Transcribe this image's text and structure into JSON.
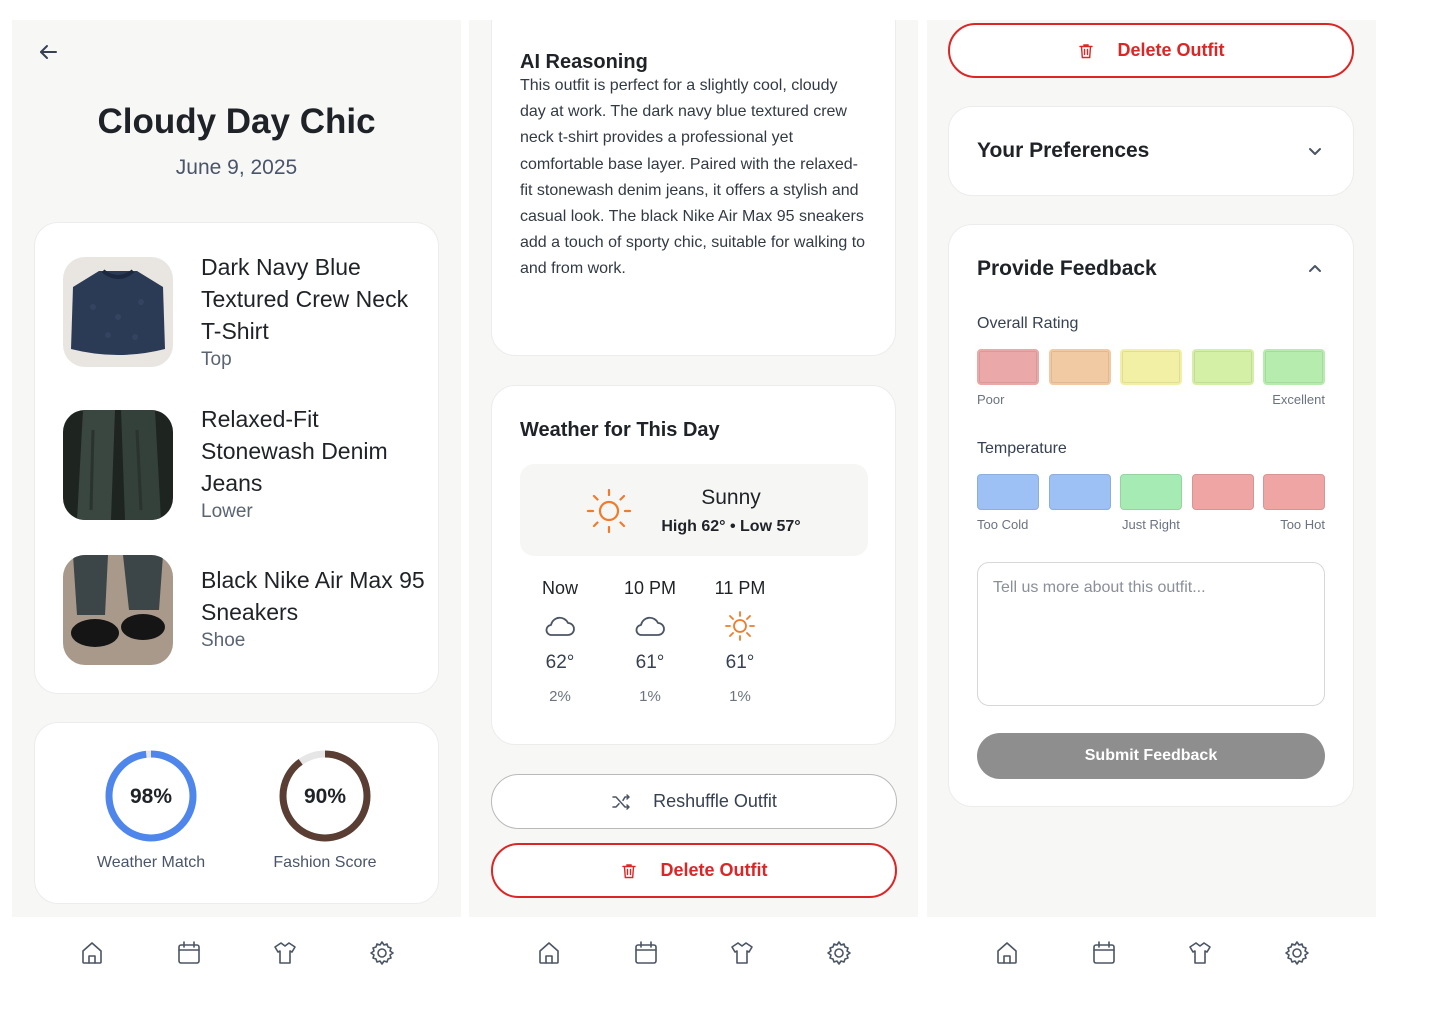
{
  "outfit": {
    "title": "Cloudy Day Chic",
    "date": "June 9, 2025",
    "items": [
      {
        "name": "Dark Navy Blue Textured Crew Neck T-Shirt",
        "category": "Top"
      },
      {
        "name": "Relaxed-Fit Stonewash Denim Jeans",
        "category": "Lower"
      },
      {
        "name": "Black Nike Air Max 95 Sneakers",
        "category": "Shoe"
      }
    ],
    "scores": [
      {
        "value_text": "98%",
        "value": 0.98,
        "label": "Weather Match",
        "color": "#4f86ec"
      },
      {
        "value_text": "90%",
        "value": 0.9,
        "label": "Fashion Score",
        "color": "#5a3d33"
      }
    ]
  },
  "reasoning": {
    "title": "AI Reasoning",
    "text": "This outfit is perfect for a slightly cool, cloudy day at work. The dark navy blue textured crew neck t-shirt provides a professional yet comfortable base layer. Paired with the relaxed-fit stonewash denim jeans, it offers a stylish and casual look. The black Nike Air Max 95 sneakers add a touch of sporty chic, suitable for walking to and from work."
  },
  "weather": {
    "title": "Weather for This Day",
    "condition": "Sunny",
    "hilo": "High 62° • Low 57°",
    "hours": [
      {
        "time": "Now",
        "icon": "cloud-icon",
        "temp": "62°",
        "precip": "2%"
      },
      {
        "time": "10 PM",
        "icon": "cloud-icon",
        "temp": "61°",
        "precip": "1%"
      },
      {
        "time": "11 PM",
        "icon": "sun-icon",
        "temp": "61°",
        "precip": "1%"
      }
    ]
  },
  "actions": {
    "reshuffle": "Reshuffle Outfit",
    "delete": "Delete Outfit"
  },
  "preferences": {
    "title": "Your Preferences"
  },
  "feedback": {
    "title": "Provide Feedback",
    "rating_label": "Overall Rating",
    "rating_colors": [
      "#e8a9a9",
      "#efc9a4",
      "#f2f0a8",
      "#d5efaa",
      "#b8ebb0"
    ],
    "rating_low": "Poor",
    "rating_high": "Excellent",
    "temperature_label": "Temperature",
    "temperature_colors": [
      "#9ec1f5",
      "#9ec1f5",
      "#a7ebb4",
      "#f0a5a5",
      "#f0a5a5"
    ],
    "temp_cold": "Too Cold",
    "temp_right": "Just Right",
    "temp_hot": "Too Hot",
    "placeholder": "Tell us more about this outfit...",
    "submit": "Submit Feedback"
  },
  "nav": [
    "home-icon",
    "calendar-icon",
    "shirt-icon",
    "settings-icon"
  ],
  "theme": {
    "accent_red": "#dc2626",
    "sun_orange": "#f07b2a"
  }
}
